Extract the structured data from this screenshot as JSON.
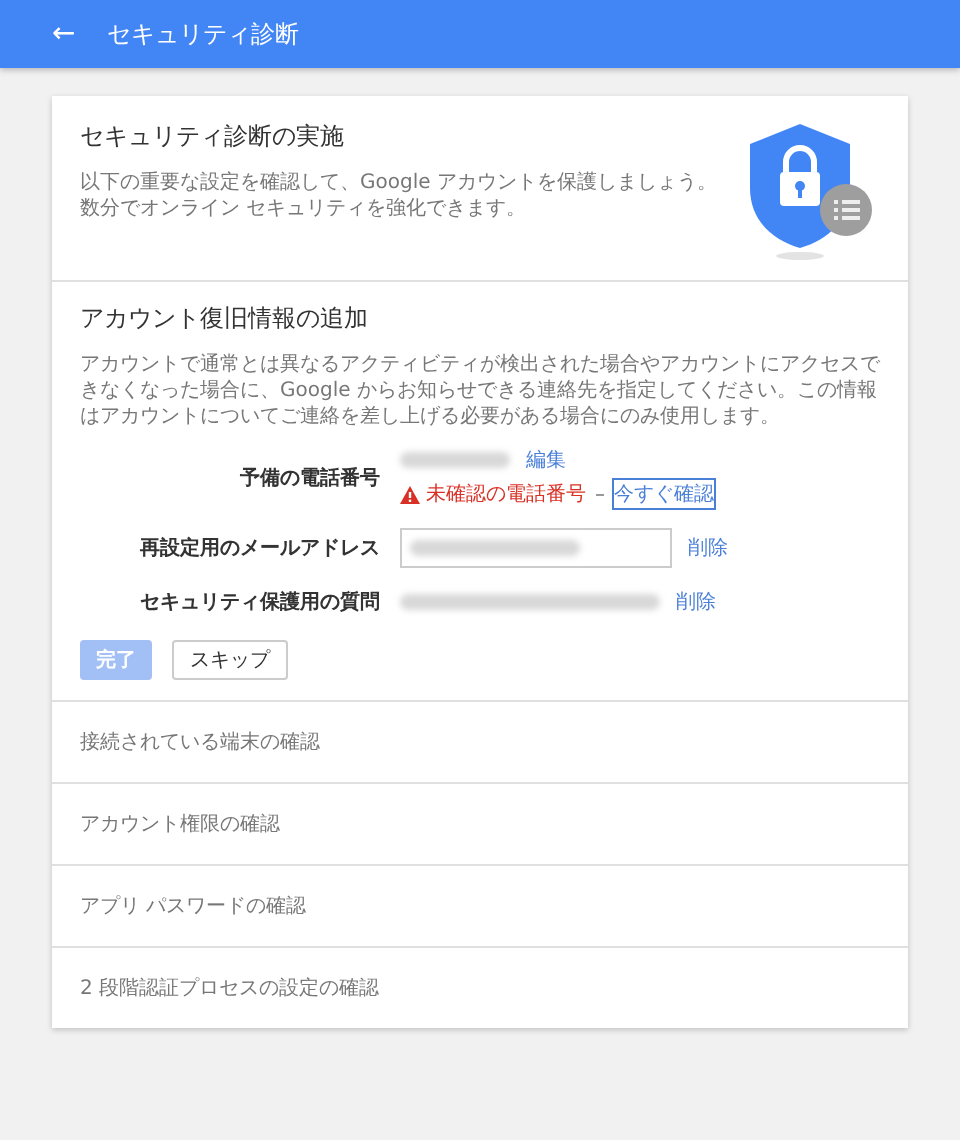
{
  "app_bar": {
    "back_icon": "←",
    "title": "セキュリティ診断"
  },
  "intro": {
    "title": "セキュリティ診断の実施",
    "text": "以下の重要な設定を確認して、Google アカウントを保護しましょう。数分でオンライン セキュリティを強化できます。"
  },
  "recovery": {
    "title": "アカウント復旧情報の追加",
    "text": "アカウントで通常とは異なるアクティビティが検出された場合やアカウントにアクセスできなくなった場合に、Google からお知らせできる連絡先を指定してください。この情報はアカウントについてご連絡を差し上げる必要がある場合にのみ使用します。",
    "fields": [
      {
        "kind": "text",
        "label": "予備の電話番号",
        "action": "編集",
        "warning": "未確認の電話番号",
        "warning_link": "今すぐ確認",
        "focused": true
      },
      {
        "kind": "input",
        "label": "再設定用のメールアドレス",
        "action": "削除"
      },
      {
        "kind": "text",
        "label": "セキュリティ保護用の質問",
        "action": "削除"
      }
    ],
    "buttons": [
      {
        "label": "完了",
        "kind": "primary",
        "disabled": true
      },
      {
        "label": "スキップ",
        "kind": "secondary",
        "disabled": false
      }
    ]
  },
  "sections": [
    {
      "label": "接続されている端末の確認"
    },
    {
      "label": "アカウント権限の確認"
    },
    {
      "label": "アプリ パスワードの確認"
    },
    {
      "label": "2 段階認証プロセスの設定の確認"
    }
  ]
}
